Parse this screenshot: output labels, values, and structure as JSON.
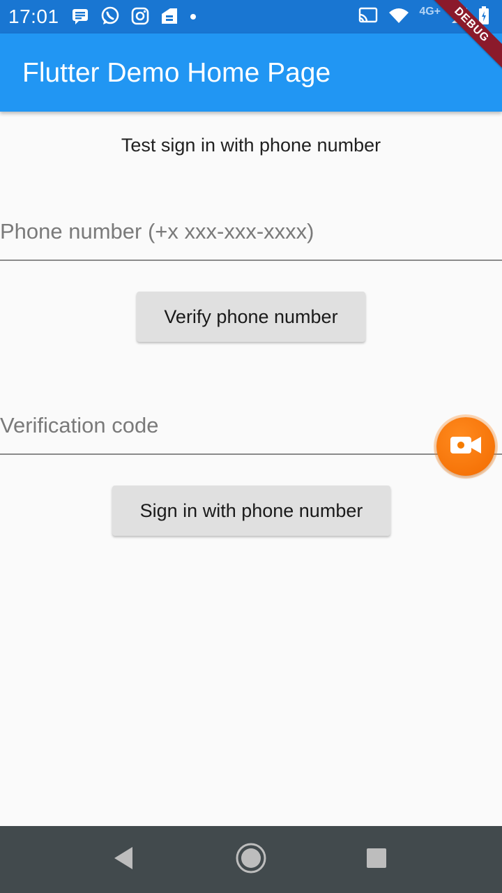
{
  "status_bar": {
    "time": "17:01",
    "network_label": "4G+",
    "left_icons": [
      "message-icon",
      "whatsapp-icon",
      "instagram-icon",
      "app-icon",
      "dot-icon"
    ],
    "right_icons": [
      "cast-icon",
      "wifi-icon",
      "signal-icon",
      "battery-icon"
    ],
    "color": "#1976d2"
  },
  "app_bar": {
    "title": "Flutter Demo Home Page",
    "color": "#2196f3"
  },
  "debug_banner": {
    "label": "DEBUG",
    "color": "#8b1a2b"
  },
  "content": {
    "heading": "Test sign in with phone number",
    "phone_field": {
      "placeholder": "Phone number (+x xxx-xxx-xxxx)",
      "value": ""
    },
    "verify_button": {
      "label": "Verify phone number"
    },
    "code_field": {
      "placeholder": "Verification code",
      "value": ""
    },
    "signin_button": {
      "label": "Sign in with phone number"
    }
  },
  "overlay": {
    "icon": "video-camera-icon",
    "color": "#f57c00"
  },
  "nav_bar": {
    "buttons": [
      "back-icon",
      "home-icon",
      "recents-icon"
    ],
    "color": "#424a4d"
  }
}
